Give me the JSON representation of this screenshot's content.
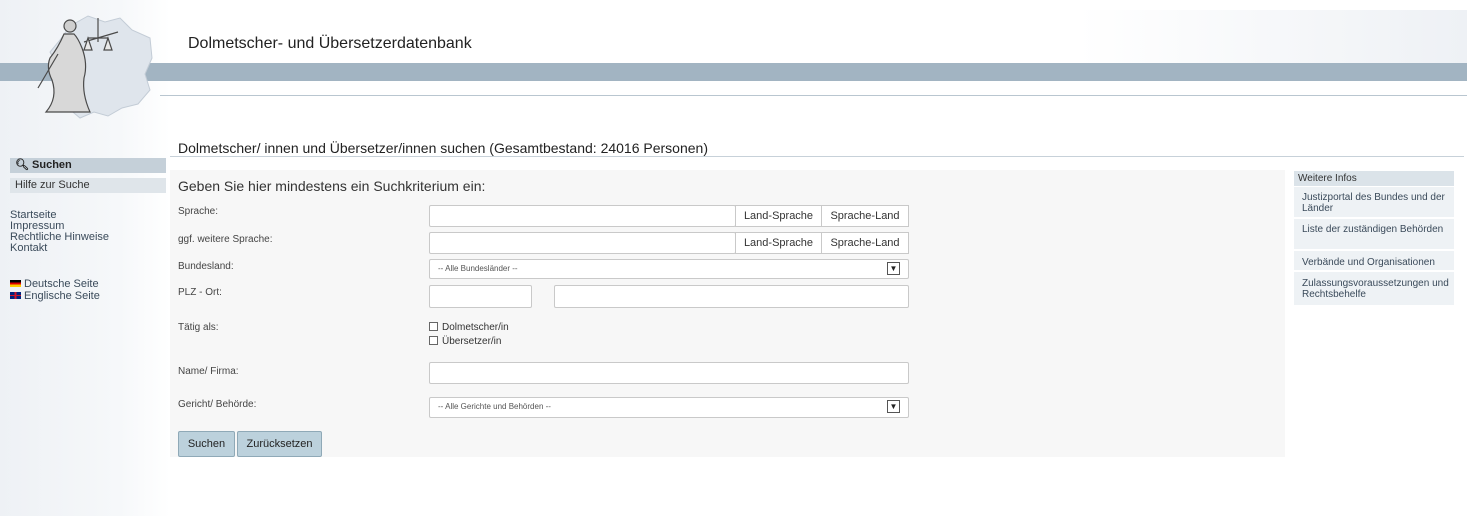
{
  "header": {
    "title": "Dolmetscher- und Übersetzerdatenbank"
  },
  "nav": {
    "suchen": "Suchen",
    "hilfe": "Hilfe zur Suche",
    "links": [
      "Startseite",
      "Impressum",
      "Rechtliche Hinweise",
      "Kontakt"
    ],
    "deutsche": "Deutsche Seite",
    "englische": "Englische Seite"
  },
  "main": {
    "title": "Dolmetscher/ innen und Übersetzer/innen suchen (Gesamtbestand: 24016 Personen)",
    "form_heading": "Geben Sie hier mindestens ein Suchkriterium ein:"
  },
  "form": {
    "sprache_label": "Sprache:",
    "weitere_label": "ggf. weitere Sprache:",
    "bundesland_label": "Bundesland:",
    "plz_label": "PLZ - Ort:",
    "taetig_label": "Tätig als:",
    "name_label": "Name/ Firma:",
    "gericht_label": "Gericht/ Behörde:",
    "land_sprache": "Land-Sprache",
    "sprache_land": "Sprache-Land",
    "bundesland_value": "-- Alle Bundesländer --",
    "gericht_value": "-- Alle Gerichte und Behörden --",
    "dolmetscher": "Dolmetscher/in",
    "uebersetzer": "Übersetzer/in",
    "search_button": "Suchen",
    "reset_button": "Zurücksetzen"
  },
  "sidebar": {
    "heading": "Weitere Infos",
    "items": [
      "Justizportal des Bundes und der Länder",
      "Liste der zuständigen Behörden",
      "Verbände und Organisationen",
      "Zulassungsvoraussetzungen und Rechtsbehelfe"
    ]
  },
  "colors": {
    "header_bar": "#a2b4c2",
    "button": "#bcd1dc",
    "nav_active": "#c5d0d9"
  }
}
